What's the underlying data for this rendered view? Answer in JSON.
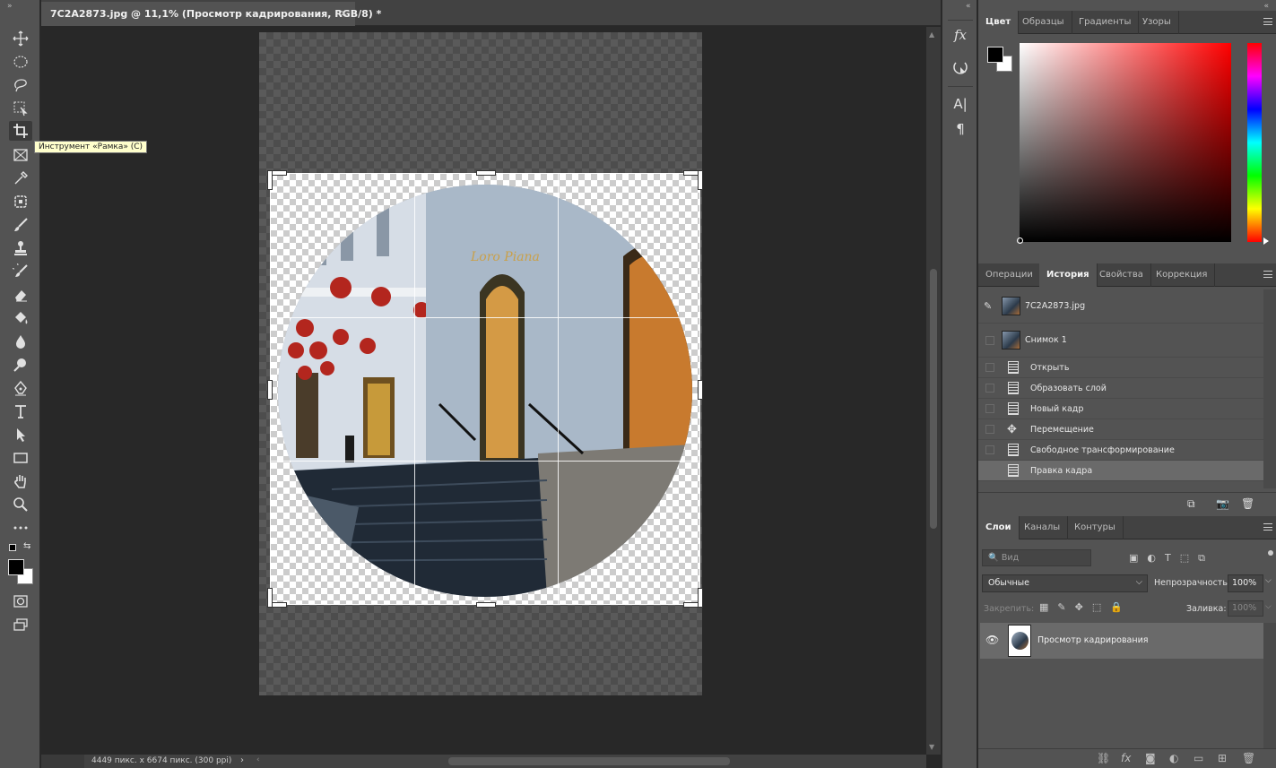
{
  "document": {
    "tab_title": "7C2A2873.jpg @ 11,1% (Просмотр кадрирования, RGB/8) *",
    "close_glyph": "×",
    "status_info": "4449 пикс. x 6674 пикс. (300 ppi)",
    "status_chevron": "›"
  },
  "toolbar": {
    "tooltip": "Инструмент «Рамка» (C)",
    "tools": [
      "move-icon",
      "marquee-icon",
      "lasso-icon",
      "object-select-icon",
      "crop-icon",
      "frame-icon",
      "eyedropper-icon",
      "patch-icon",
      "brush-icon",
      "stamp-icon",
      "history-brush-icon",
      "eraser-icon",
      "paint-bucket-icon",
      "blur-icon",
      "dodge-icon",
      "pen-icon",
      "type-icon",
      "path-select-icon",
      "rectangle-icon",
      "hand-icon",
      "zoom-icon",
      "more-icon"
    ],
    "foreground_color": "#000000",
    "background_color": "#ffffff"
  },
  "color_panel": {
    "tabs": [
      "Цвет",
      "Образцы",
      "Градиенты",
      "Узоры"
    ],
    "active_tab": "Цвет",
    "hue_color": "#ff0000"
  },
  "history_panel": {
    "tabs": [
      "Операции",
      "История",
      "Свойства",
      "Коррекция"
    ],
    "active_tab": "История",
    "snapshots": [
      "7C2A2873.jpg",
      "Снимок 1"
    ],
    "steps": [
      "Открыть",
      "Образовать слой",
      "Новый кадр",
      "Перемещение",
      "Свободное трансформирование",
      "Правка кадра"
    ],
    "selected_step": "Правка кадра"
  },
  "layers_panel": {
    "tabs": [
      "Слои",
      "Каналы",
      "Контуры"
    ],
    "active_tab": "Слои",
    "filter_placeholder": "Вид",
    "blend_mode": "Обычные",
    "opacity_label": "Непрозрачность:",
    "opacity_value": "100%",
    "lock_label": "Закрепить:",
    "fill_label": "Заливка:",
    "fill_value": "100%",
    "layers": [
      {
        "name": "Просмотр кадрирования",
        "visible": true
      }
    ]
  }
}
